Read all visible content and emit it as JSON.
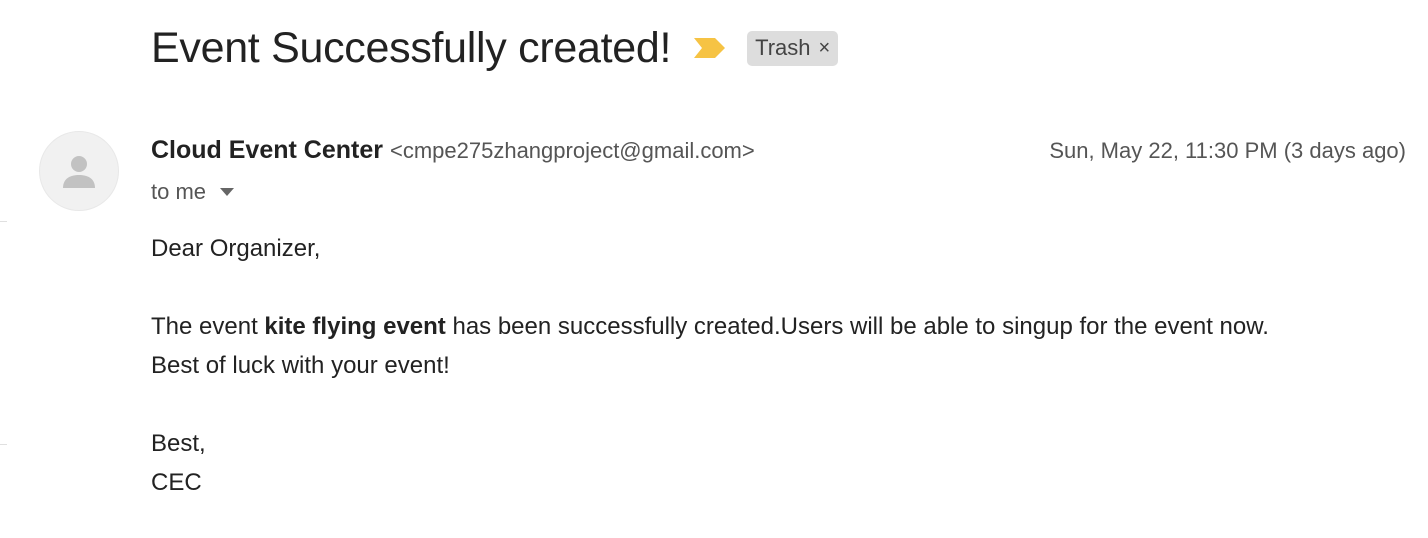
{
  "email": {
    "subject": "Event Successfully created!",
    "importance_icon": "label-important-icon",
    "importance_color": "#f6c344",
    "label": "Trash",
    "label_remove": "×",
    "sender": {
      "name": "Cloud Event Center",
      "email": "<cmpe275zhangproject@gmail.com>"
    },
    "date": "Sun, May 22, 11:30 PM (3 days ago)",
    "to": "to me",
    "body": {
      "greeting": "Dear Organizer,",
      "line1_prefix": "The event ",
      "event_name": "kite flying event",
      "line1_suffix": " has been successfully created.Users will be able to singup for the event now.",
      "line2": "Best of luck with your event!",
      "signoff": "Best,",
      "signature": "CEC"
    }
  }
}
